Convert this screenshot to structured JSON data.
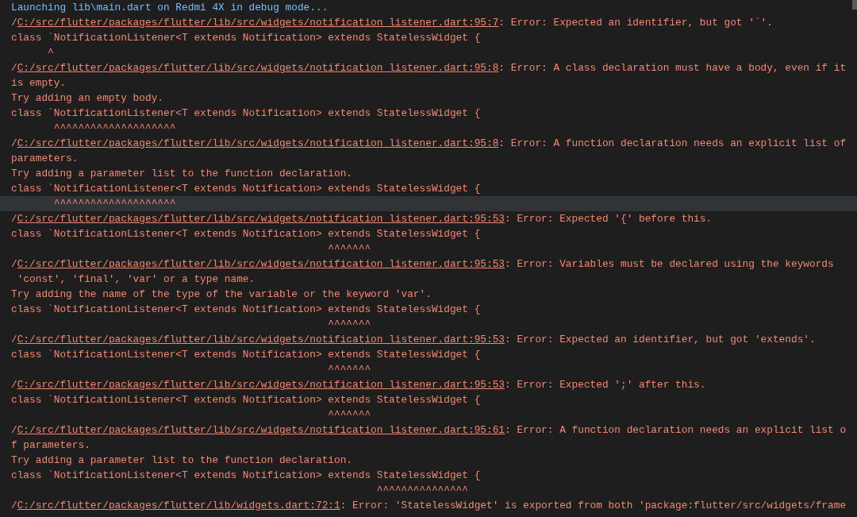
{
  "debug_console": {
    "lines": [
      {
        "kind": "info",
        "text": "Launching lib\\main.dart on Redmi 4X in debug mode...",
        "hovered": false
      },
      {
        "kind": "error",
        "prefix": "/",
        "link": "C:/src/flutter/packages/flutter/lib/src/widgets/notification_listener.dart:95:7",
        "message": ": Error: Expected an identifier, but got '`'.",
        "hovered": false
      },
      {
        "kind": "code",
        "text": "class `NotificationListener<T extends Notification> extends StatelessWidget {",
        "hovered": false
      },
      {
        "kind": "caret",
        "text": "      ^",
        "hovered": false
      },
      {
        "kind": "error",
        "prefix": "/",
        "link": "C:/src/flutter/packages/flutter/lib/src/widgets/notification_listener.dart:95:8",
        "message": ": Error: A class declaration must have a body, even if it",
        "hovered": false
      },
      {
        "kind": "text",
        "text": "is empty.",
        "hovered": false
      },
      {
        "kind": "text",
        "text": "Try adding an empty body.",
        "hovered": false
      },
      {
        "kind": "code",
        "text": "class `NotificationListener<T extends Notification> extends StatelessWidget {",
        "hovered": false
      },
      {
        "kind": "caret",
        "text": "       ^^^^^^^^^^^^^^^^^^^^",
        "hovered": false
      },
      {
        "kind": "error",
        "prefix": "/",
        "link": "C:/src/flutter/packages/flutter/lib/src/widgets/notification_listener.dart:95:8",
        "message": ": Error: A function declaration needs an explicit list of",
        "hovered": false
      },
      {
        "kind": "text",
        "text": "parameters.",
        "hovered": false
      },
      {
        "kind": "text",
        "text": "Try adding a parameter list to the function declaration.",
        "hovered": false
      },
      {
        "kind": "code",
        "text": "class `NotificationListener<T extends Notification> extends StatelessWidget {",
        "hovered": false
      },
      {
        "kind": "caret",
        "text": "       ^^^^^^^^^^^^^^^^^^^^",
        "hovered": true
      },
      {
        "kind": "error",
        "prefix": "/",
        "link": "C:/src/flutter/packages/flutter/lib/src/widgets/notification_listener.dart:95:53",
        "message": ": Error: Expected '{' before this.",
        "hovered": false
      },
      {
        "kind": "code",
        "text": "class `NotificationListener<T extends Notification> extends StatelessWidget {",
        "hovered": false
      },
      {
        "kind": "caret",
        "text": "                                                    ^^^^^^^",
        "hovered": false
      },
      {
        "kind": "error",
        "prefix": "/",
        "link": "C:/src/flutter/packages/flutter/lib/src/widgets/notification_listener.dart:95:53",
        "message": ": Error: Variables must be declared using the keywords",
        "hovered": false
      },
      {
        "kind": "text",
        "text": " 'const', 'final', 'var' or a type name.",
        "hovered": false
      },
      {
        "kind": "text",
        "text": "Try adding the name of the type of the variable or the keyword 'var'.",
        "hovered": false
      },
      {
        "kind": "code",
        "text": "class `NotificationListener<T extends Notification> extends StatelessWidget {",
        "hovered": false
      },
      {
        "kind": "caret",
        "text": "                                                    ^^^^^^^",
        "hovered": false
      },
      {
        "kind": "error",
        "prefix": "/",
        "link": "C:/src/flutter/packages/flutter/lib/src/widgets/notification_listener.dart:95:53",
        "message": ": Error: Expected an identifier, but got 'extends'.",
        "hovered": false
      },
      {
        "kind": "code",
        "text": "class `NotificationListener<T extends Notification> extends StatelessWidget {",
        "hovered": false
      },
      {
        "kind": "caret",
        "text": "                                                    ^^^^^^^",
        "hovered": false
      },
      {
        "kind": "error",
        "prefix": "/",
        "link": "C:/src/flutter/packages/flutter/lib/src/widgets/notification_listener.dart:95:53",
        "message": ": Error: Expected ';' after this.",
        "hovered": false
      },
      {
        "kind": "code",
        "text": "class `NotificationListener<T extends Notification> extends StatelessWidget {",
        "hovered": false
      },
      {
        "kind": "caret",
        "text": "                                                    ^^^^^^^",
        "hovered": false
      },
      {
        "kind": "error",
        "prefix": "/",
        "link": "C:/src/flutter/packages/flutter/lib/src/widgets/notification_listener.dart:95:61",
        "message": ": Error: A function declaration needs an explicit list o",
        "hovered": false
      },
      {
        "kind": "text",
        "text": "f parameters.",
        "hovered": false
      },
      {
        "kind": "text",
        "text": "Try adding a parameter list to the function declaration.",
        "hovered": false
      },
      {
        "kind": "code",
        "text": "class `NotificationListener<T extends Notification> extends StatelessWidget {",
        "hovered": false
      },
      {
        "kind": "caret",
        "text": "                                                            ^^^^^^^^^^^^^^^",
        "hovered": false
      },
      {
        "kind": "error",
        "prefix": "/",
        "link": "C:/src/flutter/packages/flutter/lib/widgets.dart:72:1",
        "message": ": Error: 'StatelessWidget' is exported from both 'package:flutter/src/widgets/frame",
        "hovered": false
      }
    ]
  }
}
